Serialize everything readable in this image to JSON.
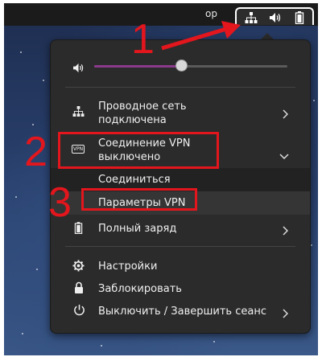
{
  "topbar": {
    "clipped_text": "op"
  },
  "menu": {
    "volume": {
      "level": 0.45
    },
    "wired": {
      "label_line1": "Проводное сеть",
      "label_line2": "подключена"
    },
    "vpn": {
      "label_line1": "Соединение VPN",
      "label_line2": "выключено",
      "icon_text": "VPN",
      "submenu": {
        "connect": "Соединиться",
        "settings": "Параметры VPN"
      }
    },
    "battery": {
      "label": "Полный заряд"
    },
    "settings": {
      "label": "Настройки"
    },
    "lock": {
      "label": "Заблокировать"
    },
    "power": {
      "label": "Выключить / Завершить сеанс"
    }
  },
  "annotations": {
    "step1": "1",
    "step2": "2",
    "step3": "3"
  },
  "colors": {
    "annotation": "#e3161d",
    "volume_fill": "#8b3a8b",
    "menu_bg": "#2b2b2b"
  }
}
